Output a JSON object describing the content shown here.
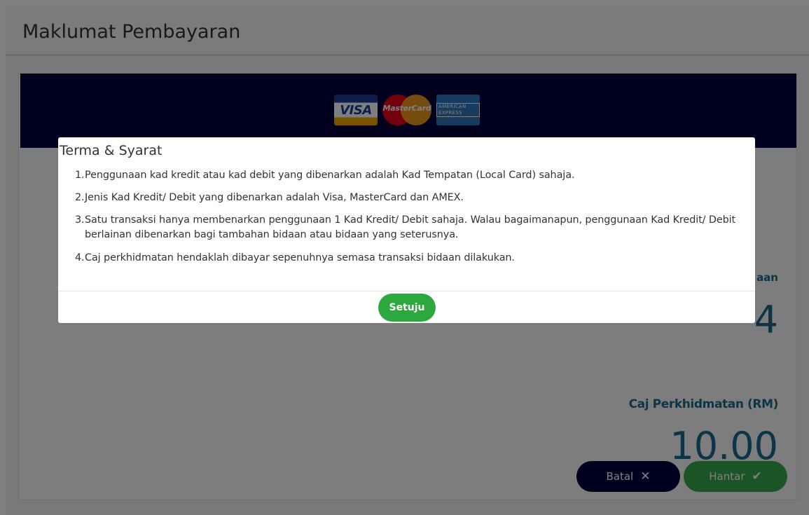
{
  "page": {
    "title": "Maklumat Pembayaran"
  },
  "payment_banner": {
    "cards": [
      {
        "name": "visa",
        "label": "VISA"
      },
      {
        "name": "mastercard",
        "label": "MasterCard"
      },
      {
        "name": "amex",
        "label": "AMERICAN EXPRESS"
      }
    ]
  },
  "amounts": {
    "label_1_partial": "aan",
    "value_1_partial": "4",
    "service_charge_label": "Caj Perkhidmatan (RM)",
    "service_charge_value": "10.00"
  },
  "actions": {
    "cancel_label": "Batal",
    "cancel_icon": "close-icon",
    "submit_label": "Hantar",
    "submit_icon": "check-icon"
  },
  "modal": {
    "title": "Terma & Syarat",
    "terms": [
      {
        "num": "1.",
        "text": "Penggunaan kad kredit atau kad debit yang dibenarkan adalah Kad Tempatan (Local Card) sahaja."
      },
      {
        "num": "2.",
        "text": "Jenis Kad Kredit/ Debit yang dibenarkan adalah Visa, MasterCard dan AMEX."
      },
      {
        "num": "3.",
        "text": "Satu transaksi hanya membenarkan penggunaan 1 Kad Kredit/ Debit sahaja. Walau bagaimanapun, penggunaan Kad Kredit/ Debit berlainan dibenarkan bagi tambahan bidaan atau bidaan yang seterusnya."
      },
      {
        "num": "4.",
        "text": "Caj perkhidmatan hendaklah dibayar sepenuhnya semasa transaksi bidaan dilakukan."
      }
    ],
    "agree_label": "Setuju"
  },
  "colors": {
    "banner": "#00003d",
    "accent_text": "#1b6a8f",
    "submit_green": "#36a84a",
    "agree_green": "#2ca83f",
    "cancel_navy": "#00003d"
  }
}
